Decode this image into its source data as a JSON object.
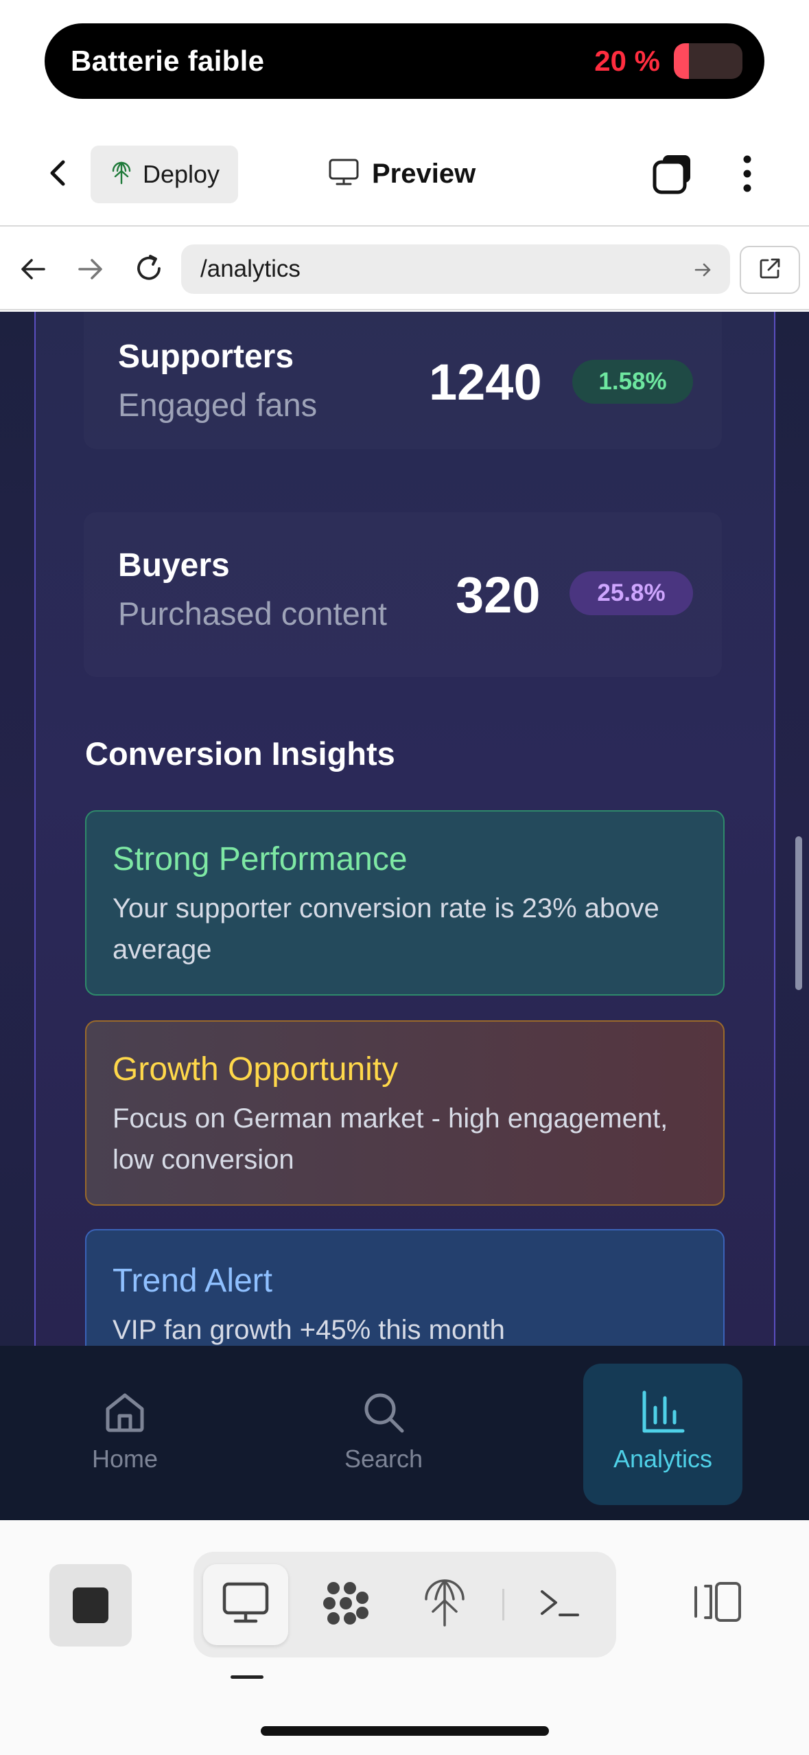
{
  "battery": {
    "title": "Batterie faible",
    "percent": "20 %",
    "level": 0.2,
    "color": "#ff2d3f"
  },
  "top_bar": {
    "deploy_label": "Deploy",
    "preview_label": "Preview",
    "icons": [
      "chevron-left-icon",
      "globe-icon",
      "monitor-icon",
      "stacked-windows-icon",
      "more-vertical-icon"
    ]
  },
  "url_bar": {
    "url": "/analytics",
    "icons": [
      "arrow-left-icon",
      "arrow-right-icon",
      "reload-icon",
      "arrow-go-icon",
      "external-link-icon"
    ]
  },
  "metrics": [
    {
      "name": "Supporters",
      "subtitle": "Engaged fans",
      "value": "1240",
      "change": "1.58%",
      "badge_color": "#6ee7a0"
    },
    {
      "name": "Buyers",
      "subtitle": "Purchased content",
      "value": "320",
      "change": "25.8%",
      "badge_color": "#cfa6ff"
    }
  ],
  "insights": {
    "title": "Conversion Insights",
    "items": [
      {
        "title": "Strong Performance",
        "body": "Your supporter conversion rate is 23% above average",
        "accent": "#7ee8a4"
      },
      {
        "title": "Growth Opportunity",
        "body": "Focus on German market - high engagement, low conversion",
        "accent": "#ffd84a"
      },
      {
        "title": "Trend Alert",
        "body": "VIP fan growth +45% this month",
        "accent": "#8fc0ff"
      }
    ]
  },
  "bottom_nav": {
    "items": [
      {
        "label": "Home",
        "icon": "home-icon",
        "active": false
      },
      {
        "label": "Search",
        "icon": "search-icon",
        "active": false
      },
      {
        "label": "Analytics",
        "icon": "bar-chart-icon",
        "active": true
      }
    ],
    "active_color": "#4fd1e8"
  },
  "tool_bar": {
    "icons": [
      "stop-icon",
      "monitor-icon",
      "network-icon",
      "deploy-icon",
      "terminal-icon",
      "panel-toggle-icon"
    ]
  }
}
